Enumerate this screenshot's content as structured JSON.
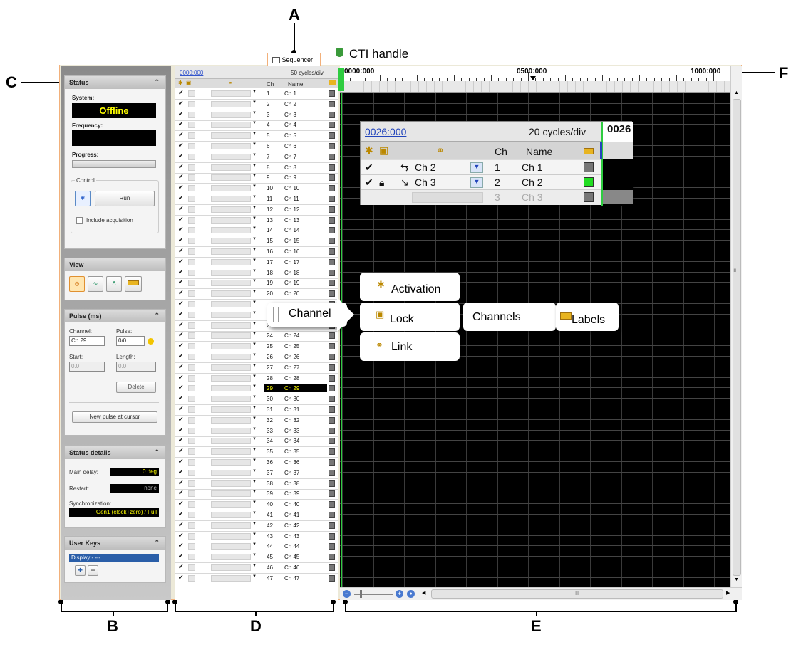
{
  "callouts": {
    "A": "A",
    "B": "B",
    "C": "C",
    "D": "D",
    "E": "E",
    "F": "F"
  },
  "cti_label": "CTI handle",
  "tab": {
    "label": "Sequencer"
  },
  "status": {
    "title": "Status",
    "system_label": "System:",
    "system_value": "Offline",
    "frequency_label": "Frequency:",
    "progress_label": "Progress:",
    "progress": 0,
    "control_label": "Control",
    "run_label": "Run",
    "include_label": "Include acquisition"
  },
  "view": {
    "title": "View"
  },
  "pulse": {
    "title": "Pulse (ms)",
    "channel_label": "Channel:",
    "channel_value": "Ch 29",
    "pulse_label": "Pulse:",
    "pulse_value": "0/0",
    "start_label": "Start:",
    "start_value": "0.0",
    "length_label": "Length:",
    "length_value": "0.0",
    "delete_label": "Delete",
    "new_pulse_label": "New pulse at cursor"
  },
  "status_details": {
    "title": "Status details",
    "main_delay_label": "Main delay:",
    "main_delay_value": "0 deg",
    "restart_label": "Restart:",
    "restart_value": "none",
    "sync_label": "Synchronization:",
    "sync_value": "Gen1 (clock+zero) / Full"
  },
  "user_keys": {
    "title": "User Keys",
    "display": "Display - ---"
  },
  "table": {
    "time": "0000:000",
    "scale": "50 cycles/div",
    "ch_header": "Ch",
    "name_header": "Name",
    "selected": 29,
    "rows": [
      {
        "n": "1",
        "name": "Ch 1"
      },
      {
        "n": "2",
        "name": "Ch 2"
      },
      {
        "n": "3",
        "name": "Ch 3"
      },
      {
        "n": "4",
        "name": "Ch 4"
      },
      {
        "n": "5",
        "name": "Ch 5"
      },
      {
        "n": "6",
        "name": "Ch 6"
      },
      {
        "n": "7",
        "name": "Ch 7"
      },
      {
        "n": "8",
        "name": "Ch 8"
      },
      {
        "n": "9",
        "name": "Ch 9"
      },
      {
        "n": "10",
        "name": "Ch 10"
      },
      {
        "n": "11",
        "name": "Ch 11"
      },
      {
        "n": "12",
        "name": "Ch 12"
      },
      {
        "n": "13",
        "name": "Ch 13"
      },
      {
        "n": "14",
        "name": "Ch 14"
      },
      {
        "n": "15",
        "name": "Ch 15"
      },
      {
        "n": "16",
        "name": "Ch 16"
      },
      {
        "n": "17",
        "name": "Ch 17"
      },
      {
        "n": "18",
        "name": "Ch 18"
      },
      {
        "n": "19",
        "name": "Ch 19"
      },
      {
        "n": "20",
        "name": "Ch 20"
      },
      {
        "n": "",
        "name": ""
      },
      {
        "n": "",
        "name": ""
      },
      {
        "n": "23",
        "name": "Ch 23"
      },
      {
        "n": "24",
        "name": "Ch 24"
      },
      {
        "n": "25",
        "name": "Ch 25"
      },
      {
        "n": "26",
        "name": "Ch 26"
      },
      {
        "n": "27",
        "name": "Ch 27"
      },
      {
        "n": "28",
        "name": "Ch 28"
      },
      {
        "n": "29",
        "name": "Ch 29"
      },
      {
        "n": "30",
        "name": "Ch 30"
      },
      {
        "n": "31",
        "name": "Ch 31"
      },
      {
        "n": "32",
        "name": "Ch 32"
      },
      {
        "n": "33",
        "name": "Ch 33"
      },
      {
        "n": "34",
        "name": "Ch 34"
      },
      {
        "n": "35",
        "name": "Ch 35"
      },
      {
        "n": "36",
        "name": "Ch 36"
      },
      {
        "n": "37",
        "name": "Ch 37"
      },
      {
        "n": "38",
        "name": "Ch 38"
      },
      {
        "n": "39",
        "name": "Ch 39"
      },
      {
        "n": "40",
        "name": "Ch 40"
      },
      {
        "n": "41",
        "name": "Ch 41"
      },
      {
        "n": "42",
        "name": "Ch 42"
      },
      {
        "n": "43",
        "name": "Ch 43"
      },
      {
        "n": "44",
        "name": "Ch 44"
      },
      {
        "n": "45",
        "name": "Ch 45"
      },
      {
        "n": "46",
        "name": "Ch 46"
      },
      {
        "n": "47",
        "name": "Ch 47"
      }
    ]
  },
  "ruler": {
    "t0": "0000:000",
    "t1": "0500:000",
    "t2": "1000:000"
  },
  "zoom": {
    "time": "0026:000",
    "scale": "20 cycles/div",
    "cti": "0026",
    "ch_header": "Ch",
    "name_header": "Name",
    "rows": [
      {
        "link": "Ch 2",
        "n": "1",
        "name": "Ch 1",
        "color": "#777777"
      },
      {
        "link": "Ch 3",
        "n": "2",
        "name": "Ch 2",
        "color": "#22dd22"
      },
      {
        "link": "",
        "n": "3",
        "name": "Ch 3",
        "color": "#777777"
      }
    ]
  },
  "legend": {
    "channel": "Channel",
    "activation": "Activation",
    "lock": "Lock",
    "link": "Link",
    "channels": "Channels",
    "labels": "Labels"
  },
  "hscroll_mark": "III",
  "vscroll_mark": "III"
}
